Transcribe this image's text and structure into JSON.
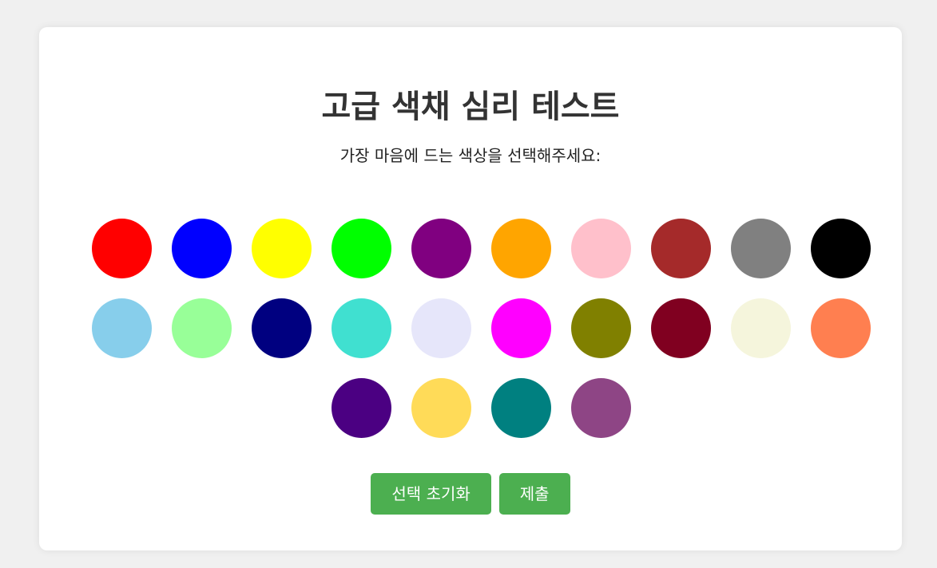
{
  "page": {
    "title": "고급 색채 심리 테스트",
    "subtitle": "가장 마음에 드는 색상을 선택해주세요:"
  },
  "colors": [
    "#ff0000",
    "#0000ff",
    "#ffff00",
    "#00ff00",
    "#800080",
    "#ffa500",
    "#ffc0cb",
    "#a52a2a",
    "#808080",
    "#000000",
    "#87ceeb",
    "#98ff98",
    "#000080",
    "#40e0d0",
    "#e6e6fa",
    "#ff00ff",
    "#808000",
    "#800020",
    "#f5f5dc",
    "#ff7f50",
    "#4b0082",
    "#ffdb58",
    "#008080",
    "#8e4585"
  ],
  "buttons": {
    "reset_label": "선택 초기화",
    "submit_label": "제출"
  },
  "accent_color": "#4caf50"
}
